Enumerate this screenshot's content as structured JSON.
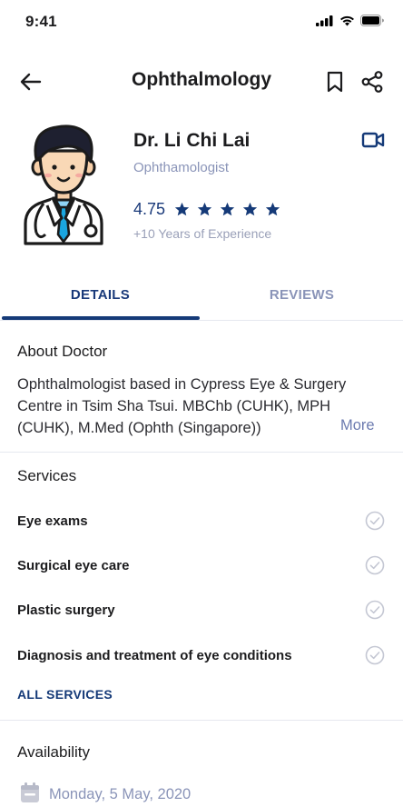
{
  "status": {
    "time": "9:41"
  },
  "header": {
    "title": "Ophthalmology"
  },
  "doctor": {
    "name": "Dr. Li Chi Lai",
    "specialty": "Ophthamologist",
    "rating": "4.75",
    "stars": 5,
    "experience": "+10 Years of Experience"
  },
  "tabs": [
    {
      "label": "DETAILS",
      "active": true
    },
    {
      "label": "REVIEWS",
      "active": false
    }
  ],
  "about": {
    "title": "About Doctor",
    "text": "Ophthalmologist based in Cypress Eye & Surgery Centre in Tsim Sha Tsui. MBChb (CUHK), MPH (CUHK), M.Med (Ophth (Singapore))",
    "more_label": "More"
  },
  "services": {
    "title": "Services",
    "items": [
      {
        "label": "Eye exams"
      },
      {
        "label": "Surgical eye care"
      },
      {
        "label": "Plastic surgery"
      },
      {
        "label": "Diagnosis and treatment of eye conditions"
      }
    ],
    "all_label": "ALL SERVICES"
  },
  "availability": {
    "title": "Availability",
    "date": "Monday, 5 May, 2020"
  },
  "colors": {
    "primary": "#153a78",
    "muted": "#8a94b8",
    "divider": "#e6e8ef"
  }
}
